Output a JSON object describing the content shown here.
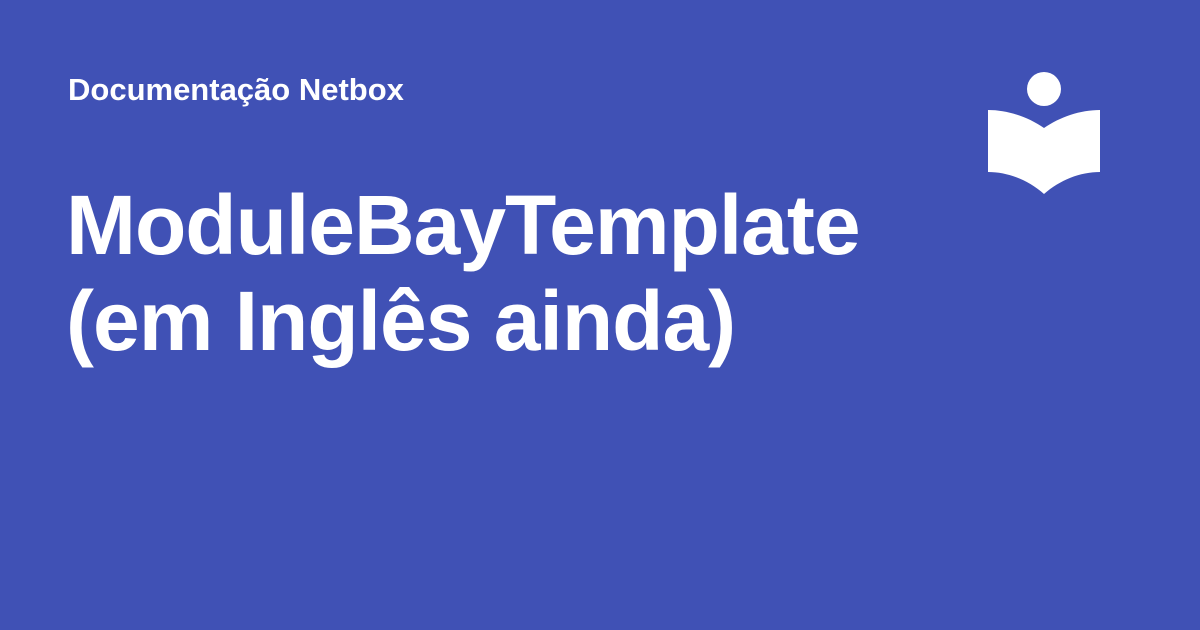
{
  "site": {
    "name": "Documentação Netbox"
  },
  "page": {
    "title_line_1": "ModuleBayTemplate",
    "title_line_2": "(em Inglês ainda)"
  },
  "logo": {
    "icon": "book-reader-icon",
    "color": "#ffffff"
  },
  "colors": {
    "background": "#4051b5",
    "text": "#ffffff"
  }
}
